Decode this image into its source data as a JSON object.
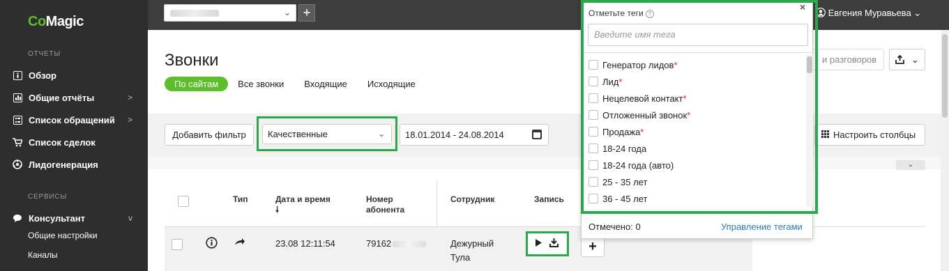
{
  "sidebar": {
    "logo_part1": "Co",
    "logo_part2": "Magic",
    "reports_label": "ОТЧЕТЫ",
    "services_label": "СЕРВИСЫ",
    "items": [
      {
        "label": "Обзор",
        "icon": "info-icon"
      },
      {
        "label": "Общие отчёты",
        "icon": "chart-icon",
        "arrow": ">"
      },
      {
        "label": "Список обращений",
        "icon": "list-icon",
        "arrow": ">"
      },
      {
        "label": "Список сделок",
        "icon": "cart-icon"
      },
      {
        "label": "Лидогенерация",
        "icon": "leadgen-icon"
      }
    ],
    "consultant": {
      "label": "Консультант",
      "arrow": "v"
    },
    "sub_items": [
      "Общие настройки",
      "Каналы"
    ]
  },
  "topbar": {
    "add_label": "+",
    "user_name": "Евгения Муравьева"
  },
  "main": {
    "title": "Звонки",
    "tabs": [
      {
        "label": "По сайтам",
        "active": true
      },
      {
        "label": "Все звонки"
      },
      {
        "label": "Входящие"
      },
      {
        "label": "Исходящие"
      }
    ],
    "history_button": "и разговоров",
    "filters": {
      "add_filter": "Добавить фильтр",
      "quality": "Качественные",
      "date_range": "18.01.2014 - 24.08.2014",
      "columns": "Настроить столбцы"
    },
    "table": {
      "headers": {
        "type": "Тип",
        "datetime": "Дата и время",
        "sort_arrow": "🠗",
        "number_line1": "Номер",
        "number_line2": "абонента",
        "employee": "Сотрудник",
        "record": "Запись"
      },
      "rows": [
        {
          "datetime": "23.08 12:11:54",
          "number": "79162",
          "employee_line1": "Дежурный",
          "employee_line2": "Тула"
        }
      ]
    }
  },
  "tags_popup": {
    "title": "Отметьте теги",
    "search_placeholder": "Введите имя тега",
    "tags": [
      {
        "label": "Генератор лидов",
        "required": true
      },
      {
        "label": "Лид",
        "required": true
      },
      {
        "label": "Нецелевой контакт",
        "required": true
      },
      {
        "label": "Отложенный звонок",
        "required": true
      },
      {
        "label": "Продажа",
        "required": true
      },
      {
        "label": "18-24 года"
      },
      {
        "label": "18-24 года (авто)"
      },
      {
        "label": "25 - 35 лет"
      },
      {
        "label": "36 - 45 лет"
      }
    ],
    "marked": "Отмечено: 0",
    "manage": "Управление тегами"
  },
  "colors": {
    "accent_green": "#5cbf2a",
    "highlight_frame": "#2aa84a",
    "sidebar_bg": "#2e2e2e",
    "topbar_bg": "#3d3d3d",
    "link": "#2b7ab8",
    "required": "#d9232e"
  }
}
